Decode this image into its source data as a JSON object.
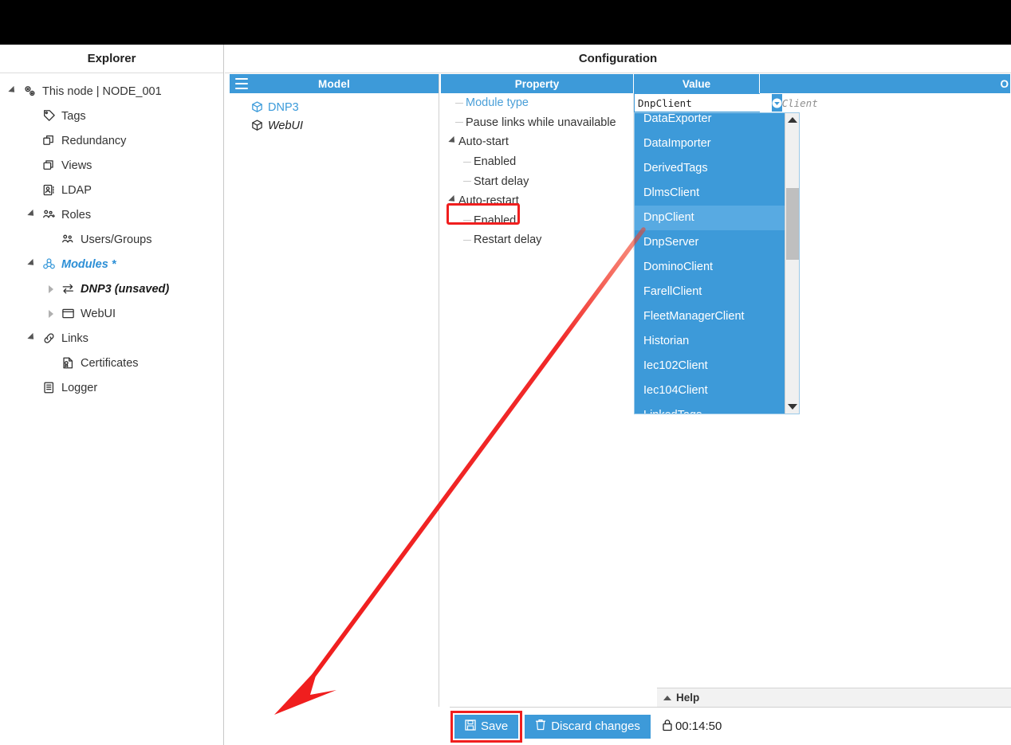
{
  "explorer": {
    "title": "Explorer",
    "items": [
      {
        "label": "This node | NODE_001",
        "icon": "gears-icon",
        "twisty": "open",
        "depth": 0,
        "style": "normal"
      },
      {
        "label": "Tags",
        "icon": "tag-icon",
        "twisty": "none",
        "depth": 1,
        "style": "normal"
      },
      {
        "label": "Redundancy",
        "icon": "redundancy-icon",
        "twisty": "none",
        "depth": 1,
        "style": "normal"
      },
      {
        "label": "Views",
        "icon": "views-icon",
        "twisty": "none",
        "depth": 1,
        "style": "normal"
      },
      {
        "label": "LDAP",
        "icon": "ldap-icon",
        "twisty": "none",
        "depth": 1,
        "style": "normal"
      },
      {
        "label": "Roles",
        "icon": "roles-icon",
        "twisty": "open",
        "depth": 1,
        "style": "normal"
      },
      {
        "label": "Users/Groups",
        "icon": "users-icon",
        "twisty": "none",
        "depth": 2,
        "style": "normal"
      },
      {
        "label": "Modules *",
        "icon": "modules-icon",
        "twisty": "open",
        "depth": 1,
        "style": "accent"
      },
      {
        "label": "DNP3 (unsaved)",
        "icon": "exchange-icon",
        "twisty": "closed",
        "depth": 2,
        "style": "italicbold"
      },
      {
        "label": "WebUI",
        "icon": "window-icon",
        "twisty": "closed",
        "depth": 2,
        "style": "normal"
      },
      {
        "label": "Links",
        "icon": "links-icon",
        "twisty": "open",
        "depth": 1,
        "style": "normal"
      },
      {
        "label": "Certificates",
        "icon": "certificate-icon",
        "twisty": "none",
        "depth": 2,
        "style": "normal"
      },
      {
        "label": "Logger",
        "icon": "logger-icon",
        "twisty": "none",
        "depth": 1,
        "style": "normal"
      }
    ]
  },
  "configuration": {
    "title": "Configuration",
    "model_panel": {
      "header": "Model",
      "menu_icon": "hamburger-icon",
      "items": [
        {
          "label": "DNP3",
          "icon": "module-cube-icon",
          "style": "selected"
        },
        {
          "label": "WebUI",
          "icon": "module-cube-icon",
          "style": "italic"
        }
      ]
    },
    "grid": {
      "headers": {
        "property": "Property",
        "value": "Value",
        "other": "O"
      },
      "rows": [
        {
          "property": "Module type",
          "depth": 1,
          "twisty": "none",
          "modified": true,
          "value": ""
        },
        {
          "property": "Pause links while unavailable",
          "depth": 1,
          "twisty": "none",
          "modified": false,
          "value": ""
        },
        {
          "property": "Auto-start",
          "depth": 0,
          "twisty": "open",
          "modified": false,
          "value": ""
        },
        {
          "property": "Enabled",
          "depth": 2,
          "twisty": "none",
          "modified": false,
          "value": ""
        },
        {
          "property": "Start delay",
          "depth": 2,
          "twisty": "none",
          "modified": false,
          "value": ""
        },
        {
          "property": "Auto-restart",
          "depth": 0,
          "twisty": "open",
          "modified": false,
          "value": ""
        },
        {
          "property": "Enabled",
          "depth": 2,
          "twisty": "none",
          "modified": false,
          "value": ""
        },
        {
          "property": "Restart delay",
          "depth": 2,
          "twisty": "none",
          "modified": false,
          "value": ""
        }
      ],
      "editor": {
        "value": "DnpClient",
        "placeholder": "DnpClient",
        "dropdown_icon": "chevron-down-icon"
      },
      "original_value": "DnpClient"
    },
    "dropdown": {
      "selected": "DnpClient",
      "options": [
        "DataExporter",
        "DataImporter",
        "DerivedTags",
        "DlmsClient",
        "DnpClient",
        "DnpServer",
        "DominoClient",
        "FarellClient",
        "FleetManagerClient",
        "Historian",
        "Iec102Client",
        "Iec104Client",
        "LinkedTags"
      ],
      "scroll_up_icon": "caret-up-icon",
      "scroll_down_icon": "caret-down-icon"
    },
    "help": {
      "label": "Help",
      "icon": "caret-up-icon"
    }
  },
  "toolbar": {
    "save_label": "Save",
    "save_icon": "save-disk-icon",
    "discard_label": "Discard changes",
    "discard_icon": "trash-icon",
    "lock_icon": "lock-icon",
    "lock_timer": "00:14:50"
  },
  "colors": {
    "accent_blue": "#3d9ad9",
    "highlight_red": "#f01e1e",
    "select_blue": "#58aae2",
    "topbar_black": "#000000"
  }
}
